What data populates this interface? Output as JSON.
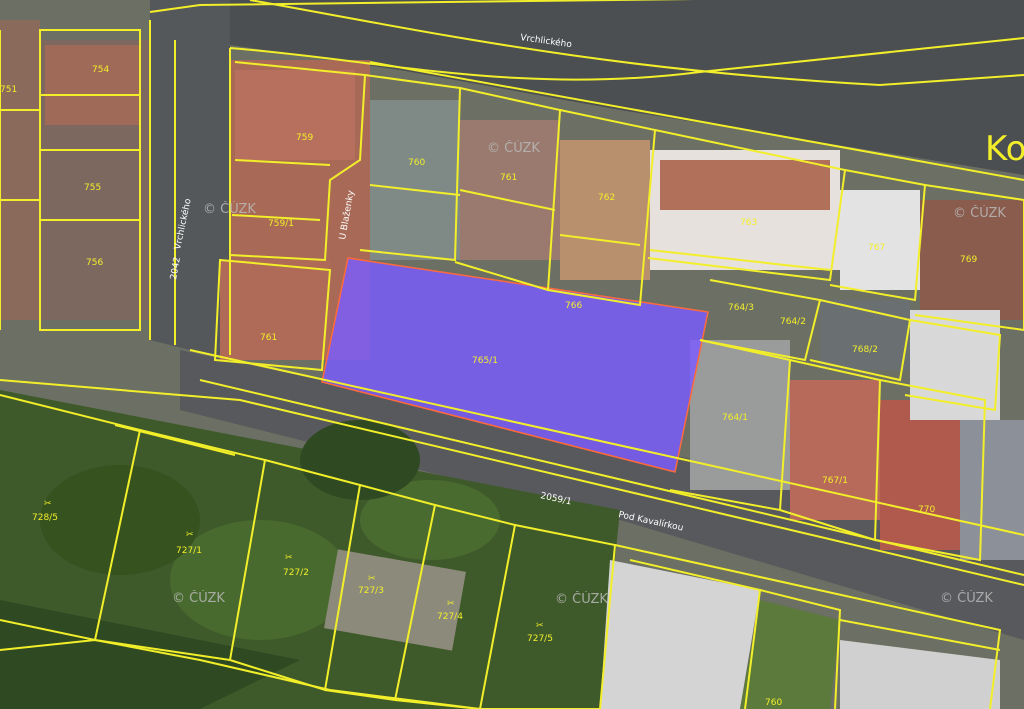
{
  "map": {
    "street_name": "Ko",
    "road_labels": [
      "2059/1",
      "Pod Kavalírkou",
      "Vrchlického",
      "2042",
      "Vrchlického",
      "U Blaženky"
    ],
    "watermarks": [
      "© ČÚZK",
      "© ČÚZK",
      "© ČÚZK",
      "© ČÚZK",
      "© ČÚZK",
      "© ČÚZK"
    ],
    "parcels": [
      "754",
      "755",
      "756",
      "759",
      "759/1",
      "760",
      "761",
      "762",
      "763",
      "764/2",
      "764/3",
      "764/1",
      "765/1",
      "766",
      "767",
      "768/2",
      "769",
      "770",
      "767/1",
      "761",
      "728/5",
      "727/1",
      "727/2",
      "727/3",
      "727/4",
      "727/5",
      "751",
      "760"
    ],
    "colors": {
      "parcel_border": "#f2ef2a",
      "selection_fill": "#7a5cff",
      "selection_border": "#ff6a3c"
    },
    "garden_symbol": "✂"
  }
}
